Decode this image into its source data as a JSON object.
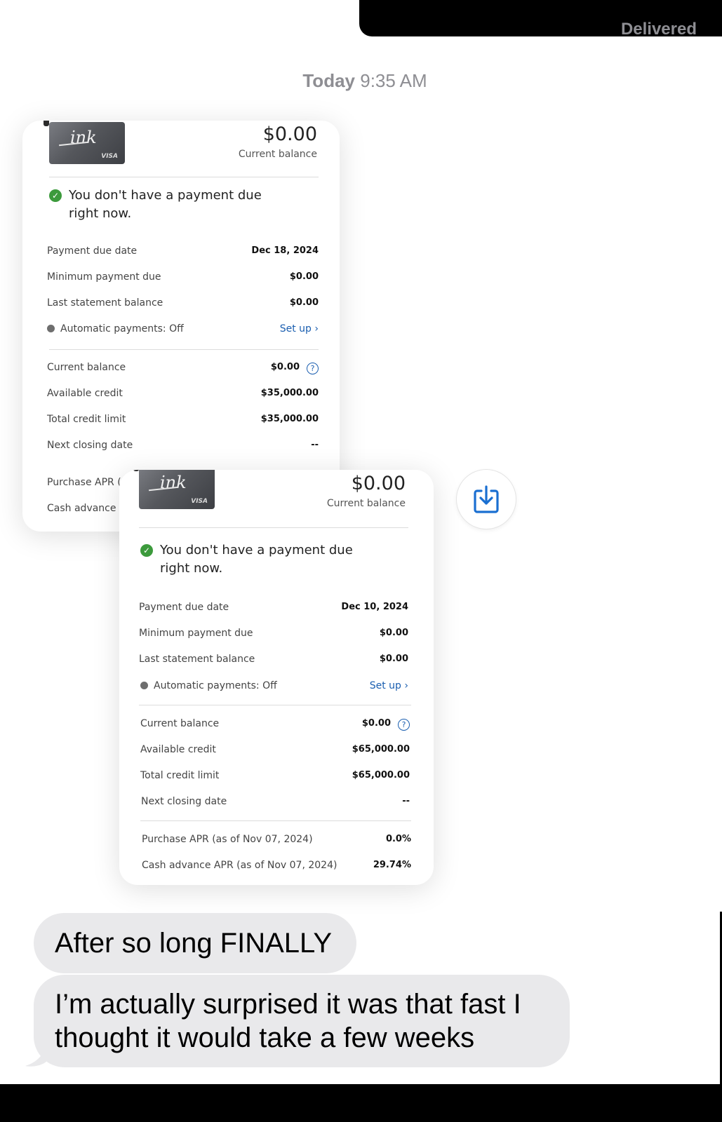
{
  "header": {
    "status": "Delivered",
    "timestamp_day": "Today",
    "timestamp_time": "9:35 AM"
  },
  "screenshots": [
    {
      "card_brand": "ink",
      "card_network": "VISA",
      "balance_amount": "$0.00",
      "balance_label": "Current balance",
      "notice": "You don't have a payment due right now.",
      "rows": [
        {
          "label": "Payment due date",
          "value": "Dec 18, 2024"
        },
        {
          "label": "Minimum payment due",
          "value": "$0.00"
        },
        {
          "label": "Last statement balance",
          "value": "$0.00"
        },
        {
          "label": "Automatic payments: Off",
          "value": "Set up"
        },
        {
          "label": "Current balance",
          "value": "$0.00"
        },
        {
          "label": "Available credit",
          "value": "$35,000.00"
        },
        {
          "label": "Total credit limit",
          "value": "$35,000.00"
        },
        {
          "label": "Next closing date",
          "value": "--"
        },
        {
          "label": "Purchase APR (a",
          "value": ""
        },
        {
          "label": "Cash advance A",
          "value": ""
        }
      ]
    },
    {
      "card_brand": "ink",
      "card_network": "VISA",
      "balance_amount": "$0.00",
      "balance_label": "Current balance",
      "notice": "You don't have a payment due right now.",
      "rows": [
        {
          "label": "Payment due date",
          "value": "Dec 10, 2024"
        },
        {
          "label": "Minimum payment due",
          "value": "$0.00"
        },
        {
          "label": "Last statement balance",
          "value": "$0.00"
        },
        {
          "label": "Automatic payments: Off",
          "value": "Set up"
        },
        {
          "label": "Current balance",
          "value": "$0.00"
        },
        {
          "label": "Available credit",
          "value": "$65,000.00"
        },
        {
          "label": "Total credit limit",
          "value": "$65,000.00"
        },
        {
          "label": "Next closing date",
          "value": "--"
        },
        {
          "label": "Purchase APR (as of Nov 07, 2024)",
          "value": "0.0%"
        },
        {
          "label": "Cash advance APR (as of Nov 07, 2024)",
          "value": "29.74%"
        }
      ]
    }
  ],
  "save_icon": "download-tray-icon",
  "messages": [
    {
      "text": "After so long FINALLY"
    },
    {
      "text": "I’m actually surprised it was that fast I thought it would take a few weeks"
    }
  ],
  "colors": {
    "bubble": "#e9e9eb",
    "link": "#1a5eb0",
    "check": "#3c9a3c"
  }
}
